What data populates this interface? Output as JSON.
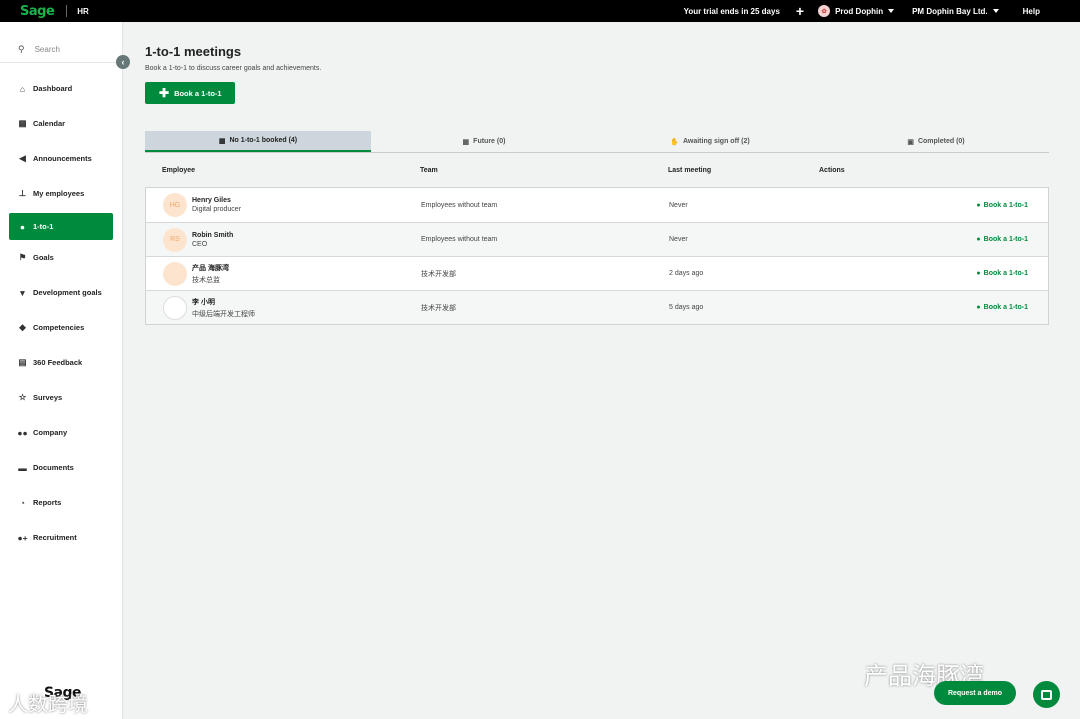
{
  "topbar": {
    "logo": "Sage",
    "product": "HR",
    "trial": "Your trial ends in 25 days",
    "plus": "+",
    "user": "Prod Dophin",
    "company": "PM Dophin Bay Ltd.",
    "help": "Help"
  },
  "sidebar": {
    "search_placeholder": "Search",
    "items": [
      {
        "label": "Dashboard",
        "icon": "home-icon",
        "glyph": "⌂"
      },
      {
        "label": "Calendar",
        "icon": "calendar-icon",
        "glyph": "▦"
      },
      {
        "label": "Announcements",
        "icon": "megaphone-icon",
        "glyph": "◀"
      },
      {
        "label": "My employees",
        "icon": "org-chart-icon",
        "glyph": "⊥"
      },
      {
        "label": "1-to-1",
        "icon": "chat-icon",
        "glyph": "●"
      },
      {
        "label": "Goals",
        "icon": "flag-icon",
        "glyph": "⚑"
      },
      {
        "label": "Development goals",
        "icon": "trophy-icon",
        "glyph": "▼"
      },
      {
        "label": "Competencies",
        "icon": "graduation-cap-icon",
        "glyph": "◆"
      },
      {
        "label": "360 Feedback",
        "icon": "clipboard-icon",
        "glyph": "▤"
      },
      {
        "label": "Surveys",
        "icon": "star-icon",
        "glyph": "☆"
      },
      {
        "label": "Company",
        "icon": "users-icon",
        "glyph": "●●"
      },
      {
        "label": "Documents",
        "icon": "folder-icon",
        "glyph": "▬"
      },
      {
        "label": "Reports",
        "icon": "pie-chart-icon",
        "glyph": "◔"
      },
      {
        "label": "Recruitment",
        "icon": "user-plus-icon",
        "glyph": "●+"
      }
    ],
    "active_index": 4,
    "footer_logo": "Sage"
  },
  "main": {
    "title": "1-to-1 meetings",
    "subtitle": "Book a 1-to-1 to discuss career goals and achievements.",
    "book_button": "Book a 1-to-1",
    "tabs": [
      {
        "label": "No 1-to-1 booked (4)",
        "icon": "calendar-icon"
      },
      {
        "label": "Future (0)",
        "icon": "calendar-icon"
      },
      {
        "label": "Awaiting sign off (2)",
        "icon": "handshake-icon"
      },
      {
        "label": "Completed (0)",
        "icon": "calendar-check-icon"
      }
    ],
    "columns": {
      "employee": "Employee",
      "team": "Team",
      "last": "Last meeting",
      "actions": "Actions"
    },
    "rows": [
      {
        "initials": "HG",
        "name": "Henry Giles",
        "role": "Digital producer",
        "team": "Employees without team",
        "last": "Never",
        "action": "Book a 1-to-1"
      },
      {
        "initials": "RS",
        "name": "Robin Smith",
        "role": "CEO",
        "team": "Employees without team",
        "last": "Never",
        "action": "Book a 1-to-1"
      },
      {
        "initials": "",
        "name": "产品 海豚湾",
        "role": "技术总监",
        "team": "技术开发部",
        "last": "2 days ago",
        "action": "Book a 1-to-1"
      },
      {
        "initials": "",
        "name": "李 小明",
        "role": "中级后端开发工程师",
        "team": "技术开发部",
        "last": "5 days ago",
        "action": "Book a 1-to-1"
      }
    ]
  },
  "watermark": {
    "right": "产品海豚湾",
    "left": "人数跨境"
  },
  "request_demo": "Request a demo",
  "colors": {
    "brand_green": "#008a3d",
    "topbar": "#000000",
    "active_tab": "#ccd6dc"
  }
}
